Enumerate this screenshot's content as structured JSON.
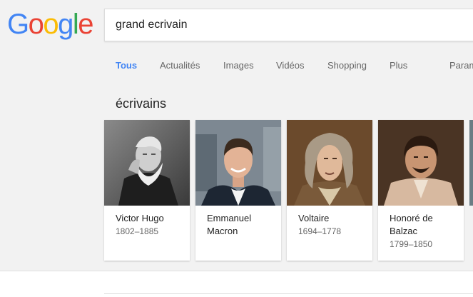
{
  "logo": {
    "letters": [
      "G",
      "o",
      "o",
      "g",
      "l",
      "e"
    ],
    "colors": [
      "#4285F4",
      "#EA4335",
      "#FBBC05",
      "#4285F4",
      "#34A853",
      "#EA4335"
    ]
  },
  "search": {
    "value": "grand ecrivain"
  },
  "tabs": [
    {
      "label": "Tous",
      "active": true
    },
    {
      "label": "Actualités"
    },
    {
      "label": "Images"
    },
    {
      "label": "Vidéos"
    },
    {
      "label": "Shopping"
    },
    {
      "label": "Plus"
    },
    {
      "label": "Param"
    }
  ],
  "section": {
    "title": "écrivains"
  },
  "cards": [
    {
      "name": "Victor Hugo",
      "dates": "1802–1885"
    },
    {
      "name": "Emmanuel Macron",
      "dates": ""
    },
    {
      "name": "Voltaire",
      "dates": "1694–1778"
    },
    {
      "name": "Honoré de Balzac",
      "dates": "1799–1850"
    }
  ],
  "colors": {
    "accent": "#4285F4",
    "background": "#f2f2f2"
  }
}
